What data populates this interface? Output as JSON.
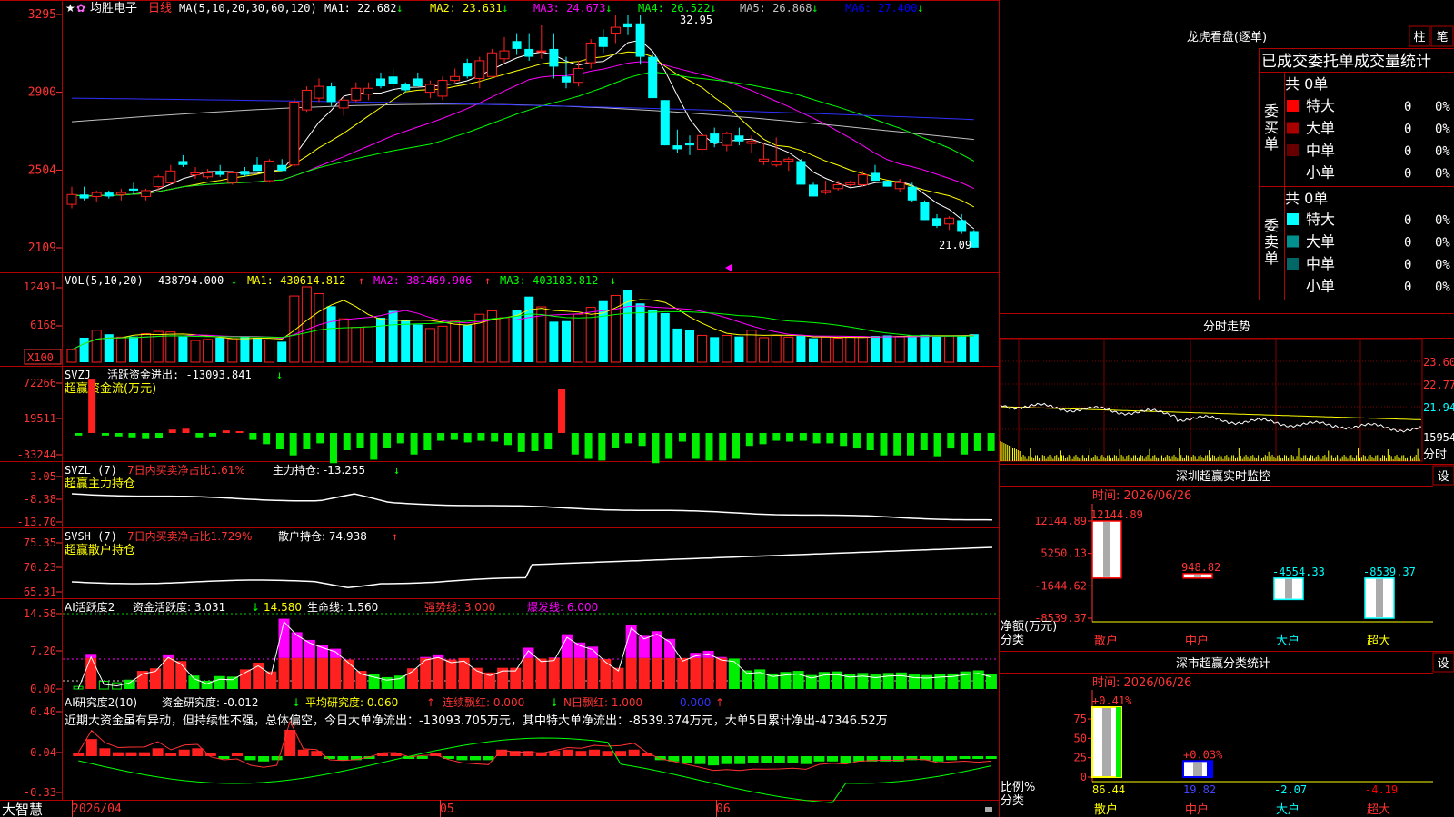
{
  "window": {
    "app_name": "大智慧"
  },
  "header": {
    "title": "均胜电子",
    "period": "日线",
    "ma_def": "MA(5,10,20,30,60,120)",
    "ma_values": [
      {
        "label": "MA1: 22.682",
        "arrow": "↓",
        "color": "#ffffff"
      },
      {
        "label": "MA2: 23.631",
        "arrow": "↓",
        "color": "#ffff00"
      },
      {
        "label": "MA3: 24.673",
        "arrow": "↓",
        "color": "#ff00ff"
      },
      {
        "label": "MA4: 26.522",
        "arrow": "↓",
        "color": "#00ff00"
      },
      {
        "label": "MA5: 26.868",
        "arrow": "↓",
        "color": "#c0c0c0"
      },
      {
        "label": "MA6: 27.400",
        "arrow": "↓",
        "color": "#0000ff"
      }
    ]
  },
  "price_panel": {
    "y_ticks": [
      "3295",
      "2900",
      "2504",
      "2109"
    ],
    "high_label": "32.95",
    "low_label": "21.09"
  },
  "volume_panel": {
    "title": "VOL(5,10,20)",
    "current": "438794.000",
    "ma1": "MA1: 430614.812",
    "ma2": "MA2: 381469.906",
    "ma3": "MA3: 403183.812",
    "y_ticks": [
      "12491",
      "6168"
    ],
    "unit": "X100"
  },
  "svzj_panel": {
    "title": "SVZJ",
    "label": "活跃资金进出: -13093.841",
    "subtitle": "超赢资金流(万元)",
    "y_ticks": [
      "72266",
      "19511",
      "-33244"
    ]
  },
  "svzl_panel": {
    "title": "SVZL (7)",
    "label_red": "7日内买卖净占比1.61%",
    "label": "主力持仓: -13.255",
    "subtitle": "超赢主力持仓",
    "y_ticks": [
      "-3.05",
      "-8.38",
      "-13.70"
    ]
  },
  "svsh_panel": {
    "title": "SVSH (7)",
    "label_red": "7日内买卖净占比1.729%",
    "label": "散户持仓: 74.938",
    "subtitle": "超赢散户持仓",
    "y_ticks": [
      "75.35",
      "70.23",
      "65.31"
    ]
  },
  "ai_active_panel": {
    "title": "AI活跃度2",
    "label1": "资金活跃度: 3.031",
    "label2": "14.580",
    "label3": "生命线: 1.560",
    "label4": "强势线: 3.000",
    "label5": "爆发线: 6.000",
    "y_ticks": [
      "14.58",
      "7.20",
      "0.00"
    ]
  },
  "ai_research_panel": {
    "title": "AI研究度2(10)",
    "label1": "资金研究度: -0.012",
    "label2": "平均研究度: 0.060",
    "label3": "连续飘红: 0.000",
    "label4": "N日飘红: 1.000",
    "label5": "0.000",
    "summary": "近期大资金虽有异动，但持续性不强，总体偏空，今日大单净流出：-13093.705万元，其中特大单净流出：-8539.374万元，大单5日累计净出-47346.52万",
    "y_ticks": [
      "0.40",
      "0.04",
      "-0.33"
    ]
  },
  "time_axis": {
    "labels": [
      "2026/04",
      "05",
      "06"
    ]
  },
  "dragon_tiger": {
    "title": "龙虎看盘(逐单)",
    "btn_bar": "柱",
    "btn_pen": "笔",
    "subtitle": "已成交委托单成交量统计",
    "buy_label": "委买单",
    "sell_label": "委卖单",
    "buy_total": "共 0单",
    "sell_total": "共 0单",
    "buy_rows": [
      {
        "name": "特大",
        "count": "0",
        "pct": "0%",
        "color": "#ff0000"
      },
      {
        "name": "大单",
        "count": "0",
        "pct": "0%",
        "color": "#aa0000"
      },
      {
        "name": "中单",
        "count": "0",
        "pct": "0%",
        "color": "#660000"
      },
      {
        "name": "小单",
        "count": "0",
        "pct": "0%",
        "color": "#000000"
      }
    ],
    "sell_rows": [
      {
        "name": "特大",
        "count": "0",
        "pct": "0%",
        "color": "#00ffff"
      },
      {
        "name": "大单",
        "count": "0",
        "pct": "0%",
        "color": "#009090"
      },
      {
        "name": "中单",
        "count": "0",
        "pct": "0%",
        "color": "#006666"
      },
      {
        "name": "小单",
        "count": "0",
        "pct": "0%",
        "color": "#000000"
      }
    ]
  },
  "intraday": {
    "title": "分时走势",
    "y_ticks": [
      "23.60",
      "22.77",
      "21.94",
      "15954"
    ],
    "unit": "分时"
  },
  "sz_monitor": {
    "title": "深圳超赢实时监控",
    "settings_btn": "设",
    "time_label": "时间: 2026/06/26",
    "y_ticks": [
      "12144.89",
      "5250.13",
      "-1644.62",
      "-8539.37"
    ],
    "y_title": "净额(万元)",
    "x_title": "分类"
  },
  "classify": {
    "title": "深市超赢分类统计",
    "settings_btn": "设",
    "time_label": "时间: 2026/06/26",
    "y_ticks": [
      "75",
      "50",
      "25",
      "0"
    ],
    "y_title": "比例%",
    "x_title": "分类"
  },
  "chart_data": [
    {
      "type": "candlestick",
      "name": "均胜电子 日线",
      "y_axis_ticks": [
        32.95,
        29.0,
        25.04,
        21.09
      ],
      "high_marker": 32.95,
      "low_marker": 21.09,
      "ohlc": [
        [
          23.3,
          24.2,
          23.1,
          23.8
        ],
        [
          23.8,
          24.2,
          23.5,
          23.6
        ],
        [
          23.7,
          24.0,
          23.4,
          23.9
        ],
        [
          23.9,
          24.0,
          23.6,
          23.7
        ],
        [
          23.8,
          24.1,
          23.5,
          23.9
        ],
        [
          24.1,
          24.4,
          23.8,
          24.0
        ],
        [
          23.7,
          24.1,
          23.5,
          24.0
        ],
        [
          24.2,
          24.8,
          24.0,
          24.7
        ],
        [
          24.4,
          25.3,
          24.3,
          25.0
        ],
        [
          25.5,
          25.8,
          25.2,
          25.3
        ],
        [
          24.8,
          25.2,
          24.6,
          24.9
        ],
        [
          24.7,
          25.1,
          24.6,
          24.9
        ],
        [
          25.0,
          25.3,
          24.7,
          24.8
        ],
        [
          24.4,
          24.9,
          24.3,
          24.9
        ],
        [
          25.0,
          25.2,
          24.7,
          24.8
        ],
        [
          25.3,
          25.7,
          25.0,
          25.0
        ],
        [
          24.5,
          25.6,
          24.4,
          25.5
        ],
        [
          25.3,
          25.6,
          25.0,
          25.0
        ],
        [
          25.3,
          28.7,
          25.2,
          28.5
        ],
        [
          28.1,
          29.3,
          28.0,
          29.1
        ],
        [
          28.7,
          29.7,
          28.5,
          29.3
        ],
        [
          29.3,
          29.5,
          28.3,
          28.5
        ],
        [
          28.2,
          28.8,
          27.8,
          28.6
        ],
        [
          28.6,
          29.5,
          28.5,
          29.2
        ],
        [
          28.9,
          29.5,
          28.6,
          29.2
        ],
        [
          29.7,
          30.0,
          29.2,
          29.3
        ],
        [
          29.8,
          30.2,
          29.1,
          29.4
        ],
        [
          29.4,
          29.5,
          29.0,
          29.1
        ],
        [
          29.7,
          30.0,
          29.3,
          29.3
        ],
        [
          29.0,
          29.6,
          28.7,
          29.4
        ],
        [
          28.8,
          29.8,
          28.6,
          29.6
        ],
        [
          29.6,
          30.2,
          29.5,
          29.8
        ],
        [
          30.5,
          30.7,
          29.7,
          29.8
        ],
        [
          29.7,
          30.8,
          29.2,
          30.6
        ],
        [
          29.8,
          31.2,
          29.8,
          31.0
        ],
        [
          30.7,
          31.8,
          30.5,
          31.1
        ],
        [
          31.6,
          32.0,
          30.9,
          31.2
        ],
        [
          31.2,
          32.0,
          30.6,
          30.8
        ],
        [
          31.1,
          32.4,
          30.7,
          31.1
        ],
        [
          31.2,
          32.0,
          29.7,
          30.3
        ],
        [
          29.8,
          30.8,
          29.2,
          29.5
        ],
        [
          29.5,
          30.6,
          29.3,
          30.2
        ],
        [
          30.5,
          31.7,
          30.2,
          31.5
        ],
        [
          31.8,
          32.2,
          31.0,
          31.3
        ],
        [
          32.0,
          32.9,
          31.5,
          32.3
        ],
        [
          32.5,
          32.95,
          31.9,
          32.3
        ],
        [
          32.5,
          32.9,
          30.4,
          30.8
        ],
        [
          30.8,
          30.9,
          29.0,
          28.7
        ],
        [
          28.6,
          28.6,
          26.3,
          26.3
        ],
        [
          26.3,
          27.1,
          25.9,
          26.1
        ],
        [
          26.4,
          26.8,
          25.8,
          26.3
        ],
        [
          26.1,
          26.9,
          25.8,
          26.8
        ],
        [
          26.9,
          27.2,
          26.2,
          26.4
        ],
        [
          26.3,
          27.0,
          26.0,
          26.9
        ],
        [
          26.8,
          27.2,
          26.3,
          26.5
        ],
        [
          26.4,
          26.8,
          25.9,
          26.5
        ],
        [
          25.5,
          26.4,
          25.3,
          25.6
        ],
        [
          25.3,
          26.7,
          25.2,
          25.5
        ],
        [
          25.5,
          25.7,
          25.0,
          25.6
        ],
        [
          25.5,
          25.6,
          24.3,
          24.3
        ],
        [
          24.3,
          24.4,
          23.7,
          23.7
        ],
        [
          23.9,
          24.5,
          23.8,
          24.0
        ],
        [
          24.1,
          24.5,
          24.0,
          24.3
        ],
        [
          24.3,
          24.5,
          24.2,
          24.4
        ],
        [
          24.3,
          25.0,
          24.2,
          24.8
        ],
        [
          24.9,
          25.3,
          24.5,
          24.5
        ],
        [
          24.5,
          24.5,
          24.2,
          24.2
        ],
        [
          24.1,
          24.6,
          23.9,
          24.4
        ],
        [
          24.2,
          24.4,
          23.4,
          23.5
        ],
        [
          23.4,
          23.5,
          22.5,
          22.5
        ],
        [
          22.6,
          22.8,
          22.1,
          22.2
        ],
        [
          22.3,
          22.7,
          22.0,
          22.6
        ],
        [
          22.5,
          22.8,
          21.8,
          21.9
        ],
        [
          21.9,
          22.0,
          21.09,
          21.1
        ]
      ]
    },
    {
      "type": "bar",
      "name": "VOL(5,10,20)",
      "y_axis_ticks": [
        12491,
        6168
      ],
      "values": [
        2.2,
        4.3,
        5.6,
        4.9,
        4.4,
        4.5,
        5.0,
        5.4,
        5.3,
        4.5,
        3.8,
        4.0,
        4.3,
        4.1,
        4.4,
        4.3,
        3.9,
        3.6,
        11.6,
        13.2,
        12.0,
        9.8,
        7.6,
        6.1,
        6.2,
        7.8,
        9.0,
        7.3,
        6.6,
        5.9,
        6.3,
        7.2,
        6.5,
        8.4,
        9.0,
        7.8,
        9.2,
        11.5,
        9.7,
        7.1,
        7.2,
        8.4,
        9.6,
        10.7,
        11.7,
        12.6,
        10.3,
        9.2,
        8.6,
        5.9,
        5.7,
        4.7,
        4.4,
        4.7,
        4.5,
        5.6,
        4.3,
        4.7,
        4.4,
        4.6,
        4.2,
        4.4,
        4.2,
        4.4,
        4.4,
        4.6,
        4.7,
        4.5,
        4.7,
        4.8,
        4.6,
        4.6,
        4.7,
        4.9,
        4.4,
        5.8
      ]
    },
    {
      "type": "bar",
      "name": "SVZJ 活跃资金进出",
      "y_axis_ticks": [
        72266,
        19511,
        -33244
      ],
      "values": [
        -0.3,
        6.2,
        -0.3,
        -0.4,
        -0.5,
        -0.7,
        -0.6,
        0.4,
        0.5,
        -0.5,
        -0.4,
        0.3,
        0.2,
        -0.8,
        -1.3,
        -1.9,
        -2.6,
        -1.9,
        -1.2,
        -3.5,
        -2.0,
        -1.7,
        -3.1,
        -1.7,
        -1.2,
        -2.5,
        -2.0,
        -0.9,
        -0.8,
        -1.1,
        -0.9,
        -1.0,
        -1.4,
        -2.2,
        -2.1,
        -1.9,
        5.1,
        -2.5,
        -3.0,
        -3.2,
        -1.7,
        -1.2,
        -1.5,
        -3.5,
        -3.0,
        -1.0,
        -3.0,
        -3.2,
        -3.2,
        -3.0,
        -1.5,
        -1.3,
        -0.9,
        -1.0,
        -0.9,
        -1.2,
        -1.2,
        -1.5,
        -1.8,
        -2.0,
        -2.6,
        -2.6,
        -2.6,
        -2.0,
        -2.7,
        -1.8,
        -2.5,
        -2.1,
        -2.1
      ]
    },
    {
      "type": "line",
      "name": "SVZL 主力持仓",
      "y_axis_ticks": [
        -3.05,
        -8.38,
        -13.7
      ],
      "series_end_value": -13.255
    },
    {
      "type": "line",
      "name": "SVSH 散户持仓",
      "y_axis_ticks": [
        75.35,
        70.23,
        65.31
      ],
      "series_end_value": 74.938
    },
    {
      "type": "bar",
      "name": "AI活跃度2",
      "y_axis_ticks": [
        14.58,
        7.2,
        0.0
      ],
      "values": [
        0.5,
        6.8,
        1.5,
        1.2,
        1.8,
        3.5,
        4.0,
        6.7,
        5.4,
        2.6,
        1.6,
        2.5,
        2.4,
        3.8,
        5.1,
        3.4,
        13.6,
        11.0,
        9.5,
        8.6,
        7.8,
        5.7,
        3.5,
        2.9,
        2.3,
        2.6,
        4.0,
        6.2,
        6.7,
        5.7,
        6.0,
        4.1,
        3.2,
        4.1,
        4.1,
        8.0,
        5.9,
        6.1,
        10.6,
        9.0,
        8.2,
        5.8,
        4.1,
        12.4,
        10.3,
        11.2,
        9.7,
        6.0,
        7.0,
        7.4,
        6.2,
        5.9,
        3.6,
        3.8,
        3.0,
        3.3,
        3.5,
        2.7,
        3.3,
        3.4,
        2.9,
        3.1,
        2.8,
        3.1,
        3.2,
        2.8,
        2.7,
        2.9,
        3.0,
        3.4,
        3.6,
        2.9
      ],
      "reference_lines": {
        "强势线": 3.0,
        "爆发线": 6.0,
        "生命线": 1.56
      }
    },
    {
      "type": "bar",
      "name": "AI研究度2(10)",
      "y_axis_ticks": [
        0.4,
        0.04,
        -0.33
      ],
      "values": [
        0.02,
        0.13,
        0.06,
        0.03,
        0.03,
        0.03,
        0.06,
        0.02,
        0.05,
        0.06,
        0.0,
        -0.01,
        0.0,
        -0.03,
        -0.04,
        -0.03,
        0.2,
        0.05,
        0.04,
        -0.02,
        -0.03,
        -0.03,
        -0.02,
        0.0,
        0.0,
        -0.02,
        -0.01,
        0.0,
        -0.02,
        -0.03,
        -0.03,
        -0.03,
        0.05,
        0.04,
        0.04,
        0.03,
        0.04,
        0.05,
        0.04,
        0.05,
        0.04,
        0.04,
        0.05,
        0.0,
        -0.03,
        -0.04,
        -0.05,
        -0.06,
        -0.07,
        -0.06,
        -0.06,
        -0.05,
        -0.05,
        -0.05,
        -0.05,
        -0.06,
        -0.04,
        -0.04,
        -0.05,
        -0.04,
        -0.04,
        -0.04,
        -0.04,
        -0.03,
        -0.03,
        -0.04,
        -0.03,
        -0.02,
        -0.02,
        -0.01
      ]
    },
    {
      "type": "bar",
      "name": "深圳超赢实时监控",
      "categories": [
        "散户",
        "中户",
        "大户",
        "超大"
      ],
      "values": [
        12144.89,
        948.82,
        -4554.33,
        -8539.37
      ],
      "category_colors": [
        "#ffffff",
        "#ffffff",
        "#ffffff",
        "#ffffff"
      ]
    },
    {
      "type": "bar",
      "name": "深市超赢分类统计",
      "categories": [
        "散户",
        "中户",
        "大户",
        "超大"
      ],
      "values": [
        86.44,
        19.82,
        -2.07,
        -4.19
      ],
      "top_labels": [
        "+0.41%",
        "+0.03%",
        "",
        ""
      ],
      "category_colors": [
        "#ffff00",
        "#0000ff",
        "#00ffff",
        "#ff0000"
      ]
    }
  ]
}
